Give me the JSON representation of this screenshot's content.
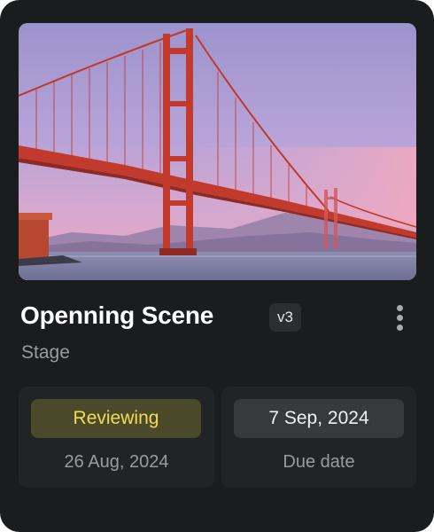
{
  "card": {
    "title": "Openning Scene",
    "version": "v3",
    "subtitle": "Stage",
    "image_icon": "golden-gate-bridge-photo",
    "menu_icon": "more-vertical-icon"
  },
  "status_panel": {
    "status": "Reviewing",
    "date": "26 Aug, 2024",
    "status_color": "#f2dc57"
  },
  "due_panel": {
    "date": "7 Sep, 2024",
    "label": "Due date"
  }
}
